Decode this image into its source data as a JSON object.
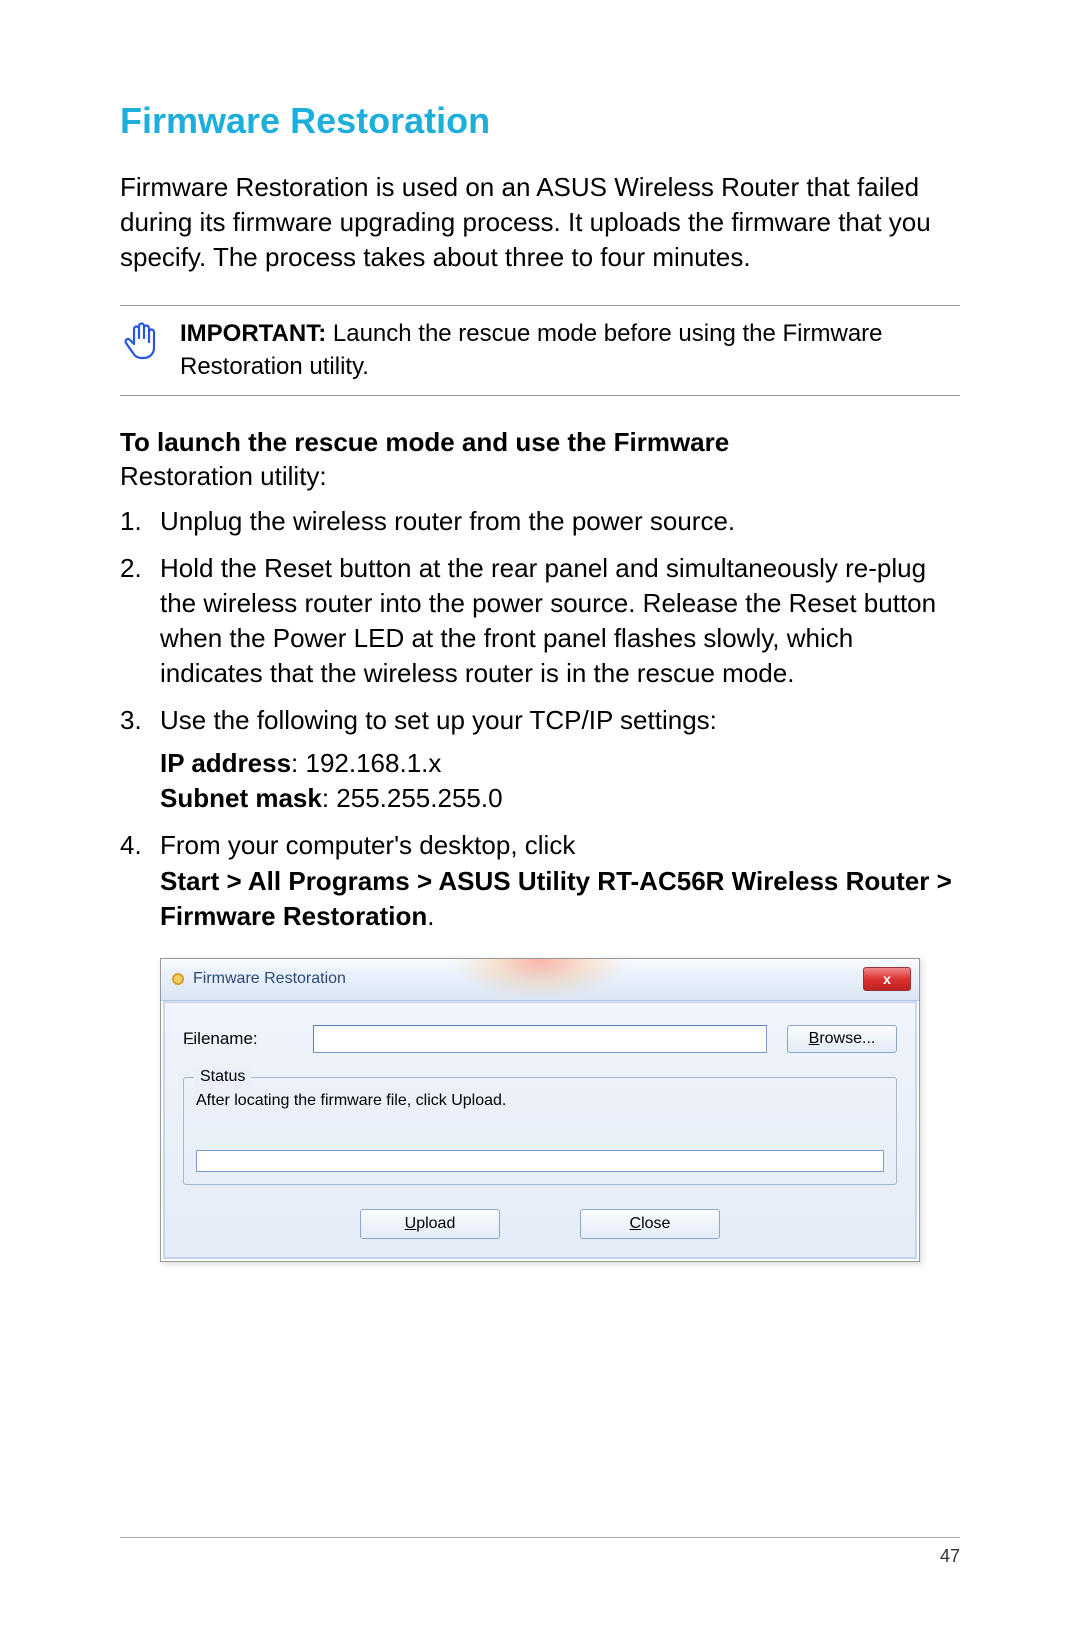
{
  "heading": "Firmware Restoration",
  "intro": "Firmware Restoration is used on an ASUS Wireless Router that failed during its firmware upgrading process. It uploads the firmware that you specify. The process takes about three to four minutes.",
  "important": {
    "label": "IMPORTANT:",
    "text": " Launch the rescue mode before using the Firmware Restoration utility."
  },
  "launch_heading_bold": "To launch the rescue mode and use the Firmware",
  "launch_heading_normal": "Restoration utility:",
  "steps": {
    "s1": "Unplug the wireless router from the power source.",
    "s2": "Hold the Reset button at the rear panel and simultaneously re-plug the wireless router into the power source. Release the Reset button when the Power LED at the front panel flashes slowly, which indicates that the wireless router is in the rescue mode.",
    "s3_intro": "Use the following to set up your TCP/IP settings:",
    "s3_ip_label": "IP address",
    "s3_ip_value": ": 192.168.1.x",
    "s3_mask_label": "Subnet mask",
    "s3_mask_value": ": 255.255.255.0",
    "s4_intro": "From your computer's desktop, click",
    "s4_path": "Start > All Programs > ASUS Utility RT-AC56R Wireless Router > Firmware Restoration",
    "s4_period": "."
  },
  "dialog": {
    "title": "Firmware Restoration",
    "filename_label": "Filename:",
    "filename_value": "",
    "browse_label": "Browse...",
    "status_legend": "Status",
    "status_text": "After locating the firmware file, click Upload.",
    "upload_label": "Upload",
    "close_label": "Close",
    "close_x": "x"
  },
  "page_number": "47"
}
